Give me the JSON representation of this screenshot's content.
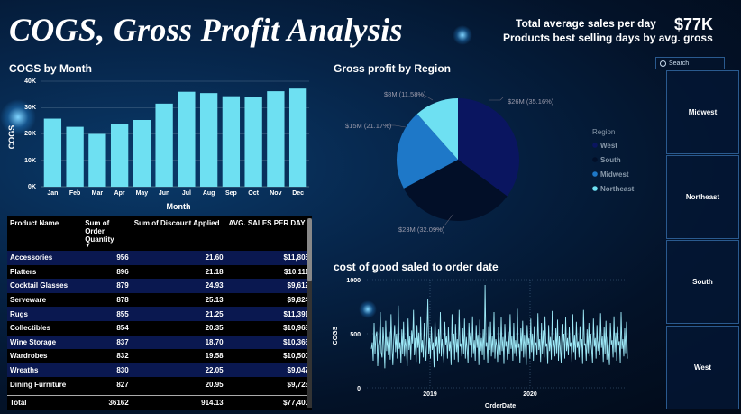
{
  "header": {
    "title": "COGS, Gross Profit Analysis",
    "kpi1_label": "Total average sales per day",
    "kpi1_value": "$77K",
    "kpi2_label": "Products best selling days by avg. gross"
  },
  "colors": {
    "bar": "#6ee0f2",
    "west": "#0a1560",
    "south": "#020f28",
    "midwest": "#1e78c8",
    "northeast": "#6ee0f2",
    "line": "#9eeaf8"
  },
  "cogs_chart": {
    "title": "COGS by Month",
    "xlabel": "Month",
    "ylabel": "COGS",
    "yticks": [
      "40K",
      "30K",
      "20K",
      "10K",
      "0K"
    ]
  },
  "pie_chart": {
    "title": "Gross profit by Region",
    "legend_title": "Region",
    "labels": [
      "$26M (35.16%)",
      "$23M (32.09%)",
      "$15M (21.17%)",
      "$8M (11.58%)"
    ]
  },
  "line_chart": {
    "title": "cost of good saled to order date",
    "xlabel": "OrderDate",
    "ylabel": "COGS",
    "yticks": [
      "1000",
      "500",
      "0"
    ],
    "xticks": [
      "2019",
      "2020"
    ]
  },
  "table": {
    "headers": [
      "Product Name",
      "Sum of Order Quantity",
      "Sum of Discount Applied",
      "AVG. SALES PER DAY"
    ],
    "rows": [
      [
        "Accessories",
        "956",
        "21.60",
        "$11,805"
      ],
      [
        "Platters",
        "896",
        "21.18",
        "$10,111"
      ],
      [
        "Cocktail Glasses",
        "879",
        "24.93",
        "$9,612"
      ],
      [
        "Serveware",
        "878",
        "25.13",
        "$9,824"
      ],
      [
        "Rugs",
        "855",
        "21.25",
        "$11,391"
      ],
      [
        "Collectibles",
        "854",
        "20.35",
        "$10,968"
      ],
      [
        "Wine Storage",
        "837",
        "18.70",
        "$10,366"
      ],
      [
        "Wardrobes",
        "832",
        "19.58",
        "$10,500"
      ],
      [
        "Wreaths",
        "830",
        "22.05",
        "$9,047"
      ],
      [
        "Dining Furniture",
        "827",
        "20.95",
        "$9,728"
      ]
    ],
    "total": [
      "Total",
      "36162",
      "914.13",
      "$77,400"
    ]
  },
  "slicer": {
    "search_placeholder": "Search",
    "items": [
      "Midwest",
      "Northeast",
      "South",
      "West"
    ]
  },
  "chart_data": [
    {
      "type": "bar",
      "title": "COGS by Month",
      "xlabel": "Month",
      "ylabel": "COGS",
      "categories": [
        "Jan",
        "Feb",
        "Mar",
        "Apr",
        "May",
        "Jun",
        "Jul",
        "Aug",
        "Sep",
        "Oct",
        "Nov",
        "Dec"
      ],
      "values": [
        25800,
        22700,
        20000,
        23800,
        25300,
        31500,
        36000,
        35500,
        34300,
        34100,
        36200,
        37200
      ],
      "ylim": [
        0,
        40000
      ],
      "grid": true
    },
    {
      "type": "pie",
      "title": "Gross profit by Region",
      "legend_title": "Region",
      "legend_position": "right",
      "slices": [
        {
          "name": "West",
          "value": 26,
          "percent": 35.16,
          "label": "$26M (35.16%)"
        },
        {
          "name": "South",
          "value": 23,
          "percent": 32.09,
          "label": "$23M (32.09%)"
        },
        {
          "name": "Midwest",
          "value": 15,
          "percent": 21.17,
          "label": "$15M (21.17%)"
        },
        {
          "name": "Northeast",
          "value": 8,
          "percent": 11.58,
          "label": "$8M (11.58%)"
        }
      ]
    },
    {
      "type": "line",
      "title": "cost of good saled to order date",
      "xlabel": "OrderDate",
      "ylabel": "COGS",
      "xticks": [
        "2019",
        "2020"
      ],
      "ylim": [
        0,
        1000
      ],
      "series": [
        {
          "values": [
            360,
            420,
            250,
            600,
            310,
            480,
            520,
            200,
            390,
            450,
            700,
            330,
            280,
            560,
            410,
            180,
            620,
            340,
            470,
            300,
            520,
            260,
            680,
            390,
            210,
            440,
            580,
            330,
            500,
            270,
            760,
            360,
            420,
            230,
            540,
            310,
            610,
            290,
            450,
            380,
            200,
            640,
            350,
            480,
            260,
            530,
            410,
            720,
            300,
            460,
            240,
            580,
            370,
            510,
            220,
            660,
            330,
            440,
            280,
            600,
            390,
            250,
            500,
            820,
            310,
            460,
            270,
            570,
            350,
            420,
            190,
            630,
            380,
            470,
            250,
            540,
            320,
            700,
            290,
            450,
            360,
            230,
            610,
            400,
            480,
            270,
            560,
            340,
            430,
            210,
            680,
            370,
            500,
            260,
            590,
            330,
            450,
            240,
            720,
            380,
            410,
            290,
            550,
            310,
            640,
            270,
            470,
            350,
            230,
            600,
            390,
            510,
            280,
            660,
            320,
            440,
            250,
            580,
            370,
            490,
            210,
            630,
            340,
            460,
            300,
            540,
            260,
            950,
            380,
            420,
            230,
            570,
            350,
            610,
            290,
            480,
            330,
            700,
            270,
            450,
            390,
            240,
            560,
            410,
            300,
            650,
            340,
            470,
            220,
            590,
            380,
            430,
            260,
            520,
            310,
            680,
            360,
            480,
            250,
            600,
            320,
            440,
            290,
            730,
            370,
            410,
            230,
            550,
            340,
            620,
            280,
            490,
            360,
            210,
            580,
            400,
            460,
            270,
            640,
            330,
            500,
            250,
            570,
            390,
            420,
            300,
            690,
            350,
            450,
            240,
            600,
            310,
            530,
            280,
            660,
            380,
            410,
            220,
            580,
            340,
            470,
            260,
            710,
            370,
            440,
            290,
            550,
            320,
            630,
            250,
            480,
            360,
            230,
            590,
            410,
            500,
            270,
            650,
            340,
            460,
            300,
            560,
            380,
            420,
            240,
            680,
            330,
            490,
            260,
            610,
            370,
            430,
            280,
            570,
            350,
            450,
            220,
            720,
            390,
            410,
            250,
            540,
            320,
            600,
            290,
            500,
            360,
            230,
            640,
            380,
            460,
            270,
            580,
            340,
            430,
            300,
            690,
            370,
            480,
            240,
            560,
            310,
            620,
            260,
            470,
            350,
            210,
            600,
            400,
            440,
            280,
            660,
            330,
            510,
            250,
            570,
            390,
            430,
            230,
            700,
            360,
            450,
            290,
            550,
            320,
            610,
            270
          ]
        }
      ]
    }
  ]
}
